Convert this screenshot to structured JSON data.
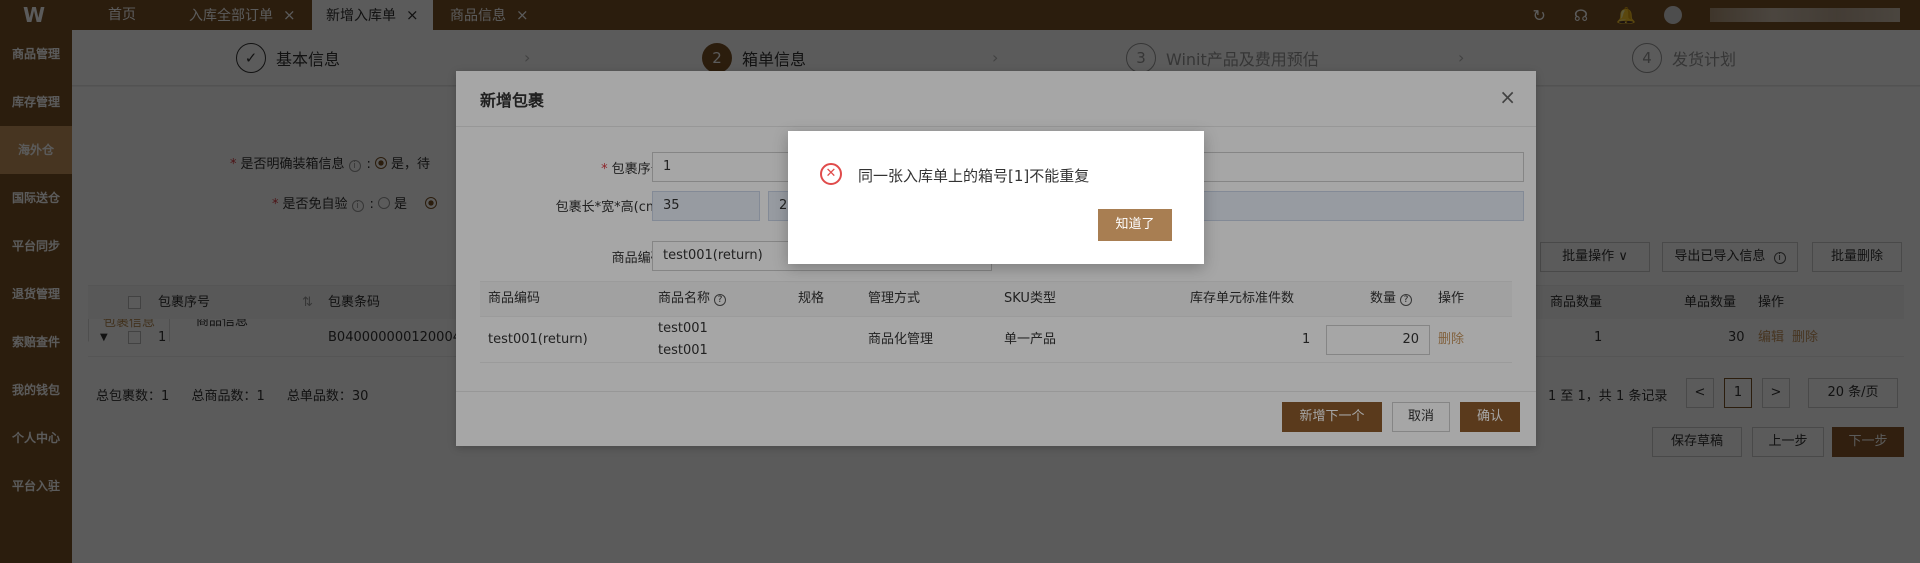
{
  "topbar": {
    "logo": "W",
    "tabs": [
      {
        "label": "首页",
        "closable": false,
        "active": false
      },
      {
        "label": "入库全部订单",
        "closable": true,
        "active": false
      },
      {
        "label": "新增入库单",
        "closable": true,
        "active": true
      },
      {
        "label": "商品信息",
        "closable": true,
        "active": false
      }
    ],
    "close_glyph": "×",
    "icons": [
      "refresh-icon",
      "headset-icon",
      "bell-icon",
      "avatar"
    ]
  },
  "sidebar": {
    "items": [
      {
        "label": "商品管理"
      },
      {
        "label": "库存管理"
      },
      {
        "label": "海外仓",
        "active": true
      },
      {
        "label": "国际送仓"
      },
      {
        "label": "平台同步"
      },
      {
        "label": "退货管理"
      },
      {
        "label": "索赔查件"
      },
      {
        "label": "我的钱包"
      },
      {
        "label": "个人中心"
      },
      {
        "label": "平台入驻"
      }
    ]
  },
  "steps": [
    {
      "num": "✓",
      "label": "基本信息",
      "state": "done"
    },
    {
      "num": "2",
      "label": "箱单信息",
      "state": "active"
    },
    {
      "num": "3",
      "label": "Winit产品及费用预估",
      "state": "future"
    },
    {
      "num": "4",
      "label": "发货计划",
      "state": "future"
    }
  ],
  "form": {
    "q1_label": "是否明确装箱信息",
    "q1_opt_yes": "是，待",
    "q2_label": "是否免自验",
    "q2_opt_yes": "是"
  },
  "subtabs": [
    "包裹信息",
    "商品信息"
  ],
  "main_table": {
    "headers": [
      "包裹序号",
      "包裹条码",
      "商品数量",
      "单品数量",
      "操作"
    ],
    "row": {
      "seq": "1",
      "barcode": "B0400000001200041",
      "goods_qty": "1",
      "item_qty": "30",
      "edit": "编辑",
      "delete": "删除"
    }
  },
  "toolbar": {
    "batch_ops": "批量操作",
    "export": "导出已导入信息",
    "batch_delete": "批量删除"
  },
  "totals": {
    "pkg": "总包裹数：",
    "pkg_val": "1",
    "goods": "总商品数：",
    "goods_val": "1",
    "items": "总单品数：",
    "items_val": "30"
  },
  "pagination": {
    "summary": "1 至 1，共 1 条记录",
    "prev": "<",
    "page": "1",
    "next": ">",
    "page_size": "20 条/页"
  },
  "footer_buttons": {
    "save_draft": "保存草稿",
    "prev_step": "上一步",
    "next_step": "下一步"
  },
  "dialog": {
    "title": "新增包裹",
    "close": "×",
    "seq_label": "包裹序号",
    "seq_value": "1",
    "dims_label": "包裹长*宽*高(cm)",
    "dim_l": "35",
    "dim_w": "2",
    "code_label": "商品编码",
    "code_value": "test001(return)",
    "table_headers": [
      "商品编码",
      "商品名称",
      "规格",
      "管理方式",
      "SKU类型",
      "库存单元标准件数",
      "数量",
      "操作"
    ],
    "row": {
      "code": "test001(return)",
      "name1": "test001",
      "name2": "test001",
      "spec": "",
      "mgmt": "商品化管理",
      "sku_type": "单一产品",
      "std_qty": "1",
      "qty": "20",
      "action": "删除"
    },
    "buttons": {
      "add_next": "新增下一个",
      "cancel": "取消",
      "confirm": "确认"
    }
  },
  "alert": {
    "message": "同一张入库单上的箱号[1]不能重复",
    "button": "知道了"
  },
  "colors": {
    "brand": "#7a5226",
    "accent": "#a87e52",
    "error": "#e04b4b"
  }
}
